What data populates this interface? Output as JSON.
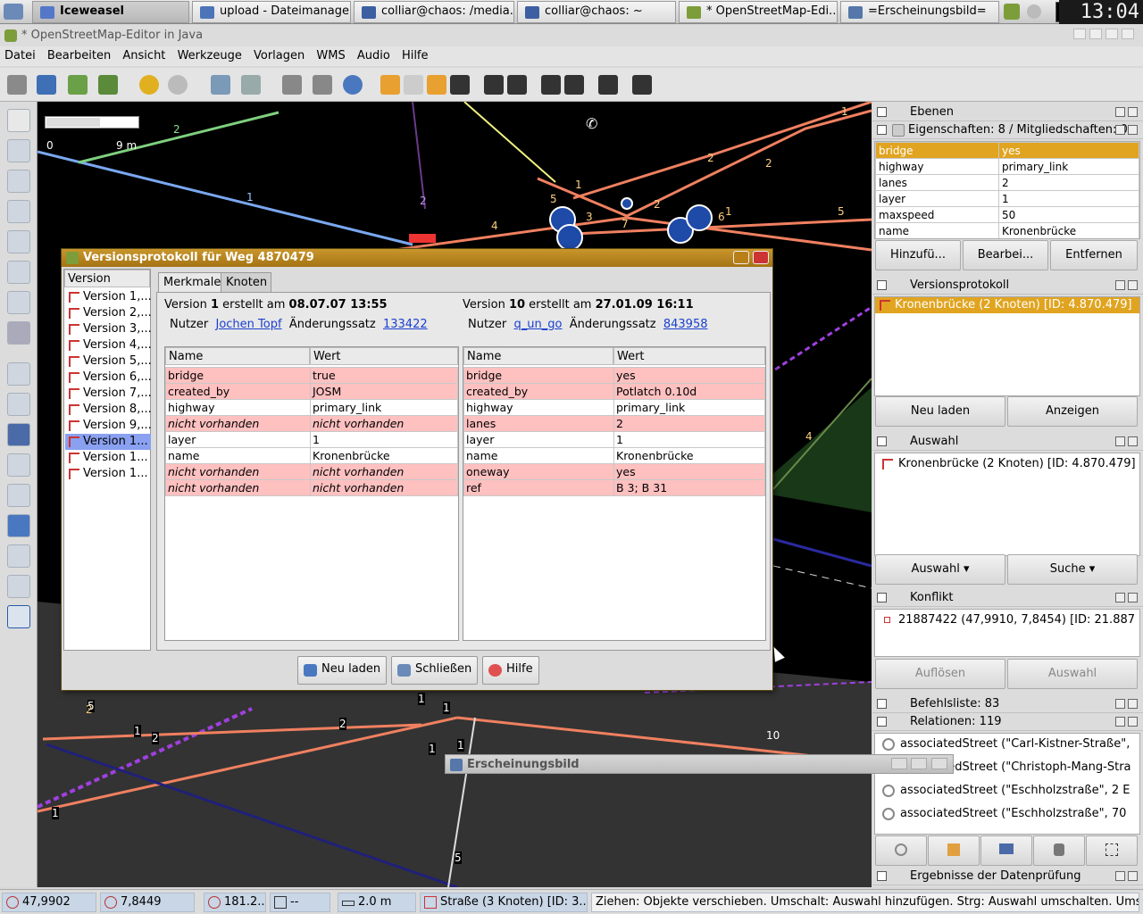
{
  "taskbar": {
    "tasks": [
      {
        "label": "Iceweasel"
      },
      {
        "label": "upload - Dateimanager"
      },
      {
        "label": "colliar@chaos: /media..."
      },
      {
        "label": "colliar@chaos: ~"
      },
      {
        "label": "* OpenStreetMap-Edi..."
      },
      {
        "label": "=Erscheinungsbild="
      }
    ],
    "clock": "13:04"
  },
  "window": {
    "title": "* OpenStreetMap-Editor in Java"
  },
  "menu": [
    "Datei",
    "Bearbeiten",
    "Ansicht",
    "Werkzeuge",
    "Vorlagen",
    "WMS",
    "Audio",
    "Hilfe"
  ],
  "scale": {
    "min": "0",
    "max": "9 m"
  },
  "map_labels": [
    "2",
    "1",
    "2",
    "5",
    "1",
    "3",
    "2",
    "7",
    "4",
    "2",
    "6",
    "1",
    "5",
    "2",
    "1",
    "4",
    "5",
    "1",
    "2",
    "1",
    "1",
    "1",
    "2",
    "1",
    "5",
    "10",
    "2",
    "1"
  ],
  "dialog": {
    "title": "Versionsprotokoll für Weg 4870479",
    "version_header": "Version",
    "versions": [
      "Version 1,...",
      "Version 2,...",
      "Version 3,...",
      "Version 4,...",
      "Version 5,...",
      "Version 6,...",
      "Version 7,...",
      "Version 8,...",
      "Version 9,...",
      "Version 1...",
      "Version 1...",
      "Version 1..."
    ],
    "selected_version_index": 9,
    "tabs": [
      "Merkmale",
      "Knoten"
    ],
    "left": {
      "v_prefix": "Version ",
      "v_num": "1",
      "v_mid": " erstellt am ",
      "v_date": "08.07.07 13:55",
      "user_label": "Nutzer",
      "user": "Jochen Topf",
      "cs_label": "Änderungssatz",
      "changeset": "133422",
      "col_name": "Name",
      "col_value": "Wert",
      "rows": [
        {
          "k": "bridge",
          "v": "true",
          "diff": true,
          "missing": false
        },
        {
          "k": "created_by",
          "v": "JOSM",
          "diff": true,
          "missing": false
        },
        {
          "k": "highway",
          "v": "primary_link",
          "diff": false,
          "missing": false
        },
        {
          "k": "nicht vorhanden",
          "v": "nicht vorhanden",
          "diff": true,
          "missing": true
        },
        {
          "k": "layer",
          "v": "1",
          "diff": false,
          "missing": false
        },
        {
          "k": "name",
          "v": "Kronenbrücke",
          "diff": false,
          "missing": false
        },
        {
          "k": "nicht vorhanden",
          "v": "nicht vorhanden",
          "diff": true,
          "missing": true
        },
        {
          "k": "nicht vorhanden",
          "v": "nicht vorhanden",
          "diff": true,
          "missing": true
        }
      ]
    },
    "right": {
      "v_prefix": "Version ",
      "v_num": "10",
      "v_mid": " erstellt am ",
      "v_date": "27.01.09 16:11",
      "user_label": "Nutzer",
      "user": "q_un_go",
      "cs_label": "Änderungssatz",
      "changeset": "843958",
      "col_name": "Name",
      "col_value": "Wert",
      "rows": [
        {
          "k": "bridge",
          "v": "yes",
          "diff": true,
          "missing": false
        },
        {
          "k": "created_by",
          "v": "Potlatch 0.10d",
          "diff": true,
          "missing": false
        },
        {
          "k": "highway",
          "v": "primary_link",
          "diff": false,
          "missing": false
        },
        {
          "k": "lanes",
          "v": "2",
          "diff": true,
          "missing": false
        },
        {
          "k": "layer",
          "v": "1",
          "diff": false,
          "missing": false
        },
        {
          "k": "name",
          "v": "Kronenbrücke",
          "diff": false,
          "missing": false
        },
        {
          "k": "oneway",
          "v": "yes",
          "diff": true,
          "missing": false
        },
        {
          "k": "ref",
          "v": "B 3; B 31",
          "diff": true,
          "missing": false
        }
      ]
    },
    "buttons": {
      "reload": "Neu laden",
      "close": "Schließen",
      "help": "Hilfe"
    }
  },
  "panels": {
    "ebenen": "Ebenen",
    "eigenschaften": "Eigenschaften: 8 / Mitgliedschaften: 0",
    "props": [
      {
        "k": "bridge",
        "v": "yes"
      },
      {
        "k": "highway",
        "v": "primary_link"
      },
      {
        "k": "lanes",
        "v": "2"
      },
      {
        "k": "layer",
        "v": "1"
      },
      {
        "k": "maxspeed",
        "v": "50"
      },
      {
        "k": "name",
        "v": "Kronenbrücke"
      }
    ],
    "prop_buttons": {
      "add": "Hinzufü...",
      "edit": "Bearbei...",
      "remove": "Entfernen"
    },
    "versionsprotokoll": "Versionsprotokoll",
    "history_item": "Kronenbrücke (2 Knoten) [ID: 4.870.479]",
    "history_buttons": {
      "reload": "Neu laden",
      "show": "Anzeigen"
    },
    "auswahl": "Auswahl",
    "selection_item": "Kronenbrücke (2 Knoten) [ID: 4.870.479]",
    "selection_buttons": {
      "select": "Auswahl",
      "search": "Suche"
    },
    "konflikt": "Konflikt",
    "conflict_item": "21887422 (47,9910, 7,8454) [ID: 21.887",
    "conflict_buttons": {
      "resolve": "Auflösen",
      "select": "Auswahl"
    },
    "befehlsliste": "Befehlsliste: 83",
    "relationen": "Relationen: 119",
    "relations": [
      "associatedStreet (\"Carl-Kistner-Straße\",",
      "associatedStreet (\"Christoph-Mang-Stra",
      "associatedStreet (\"Eschholzstraße\", 2 E",
      "associatedStreet (\"Eschholzstraße\", 70"
    ],
    "ergebnisse": "Ergebnisse der Datenprüfung"
  },
  "erscheinungsbild": {
    "title": "Erscheinungsbild"
  },
  "status": {
    "lat": "47,9902",
    "lon": "7,8449",
    "heading": "181.2...",
    "angle": "--",
    "distance": "2.0 m",
    "object": "Straße (3 Knoten) [ID: 3...",
    "hint": "Ziehen: Objekte verschieben. Umschalt: Auswahl hinzufügen. Strg: Auswahl umschalten. Umscha"
  },
  "colors": {
    "selection": "#e0a420",
    "diff": "#ffc0c0",
    "dialog_title": "#b5811c",
    "map_bg": "#000000",
    "way": "#f08060"
  }
}
